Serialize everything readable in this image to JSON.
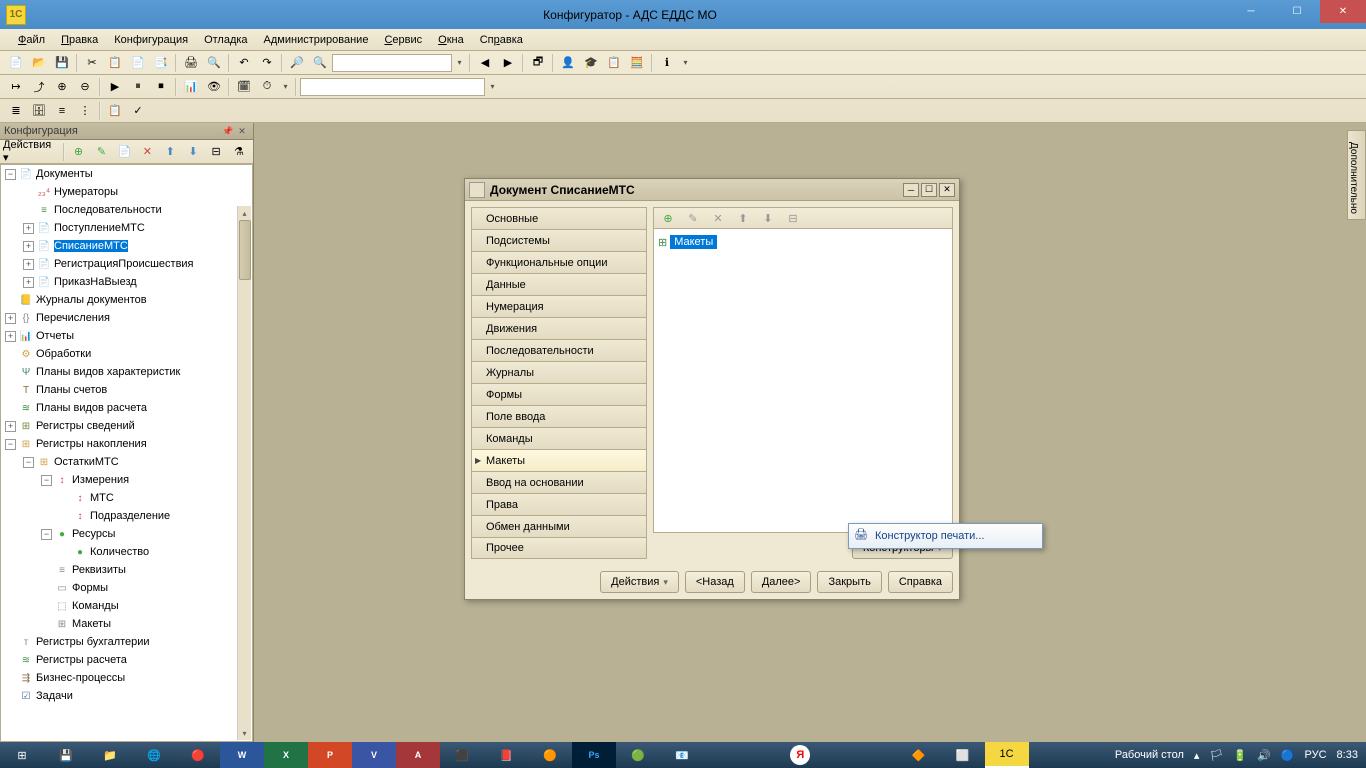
{
  "title": "Конфигуратор - АДС ЕДДС МО",
  "menu": [
    "Файл",
    "Правка",
    "Конфигурация",
    "Отладка",
    "Администрирование",
    "Сервис",
    "Окна",
    "Справка"
  ],
  "sidebar": {
    "title": "Конфигурация",
    "actions_label": "Действия"
  },
  "tree": [
    {
      "level": 0,
      "toggle": "−",
      "icon": "📄",
      "label": "Документы",
      "color": "#3a6ea5"
    },
    {
      "level": 1,
      "toggle": "",
      "icon": "₂₃⁴",
      "label": "Нумераторы",
      "color": "#c95050"
    },
    {
      "level": 1,
      "toggle": "",
      "icon": "≡",
      "label": "Последовательности",
      "color": "#4a8c4a"
    },
    {
      "level": 1,
      "toggle": "+",
      "icon": "📄",
      "label": "ПоступлениеМТС",
      "color": "#888"
    },
    {
      "level": 1,
      "toggle": "+",
      "icon": "📄",
      "label": "СписаниеМТС",
      "color": "#888",
      "selected": true
    },
    {
      "level": 1,
      "toggle": "+",
      "icon": "📄",
      "label": "РегистрацияПроисшествия",
      "color": "#888"
    },
    {
      "level": 1,
      "toggle": "+",
      "icon": "📄",
      "label": "ПриказНаВыезд",
      "color": "#888"
    },
    {
      "level": 0,
      "toggle": "",
      "icon": "📒",
      "label": "Журналы документов",
      "color": "#d4a040"
    },
    {
      "level": 0,
      "toggle": "+",
      "icon": "{}",
      "label": "Перечисления",
      "color": "#888"
    },
    {
      "level": 0,
      "toggle": "+",
      "icon": "📊",
      "label": "Отчеты",
      "color": "#4a6e8c"
    },
    {
      "level": 0,
      "toggle": "",
      "icon": "⚙",
      "label": "Обработки",
      "color": "#d4a040"
    },
    {
      "level": 0,
      "toggle": "",
      "icon": "Ψ",
      "label": "Планы видов характеристик",
      "color": "#3a8c6e"
    },
    {
      "level": 0,
      "toggle": "",
      "icon": "Т",
      "label": "Планы счетов",
      "color": "#8c6e3a"
    },
    {
      "level": 0,
      "toggle": "",
      "icon": "≋",
      "label": "Планы видов расчета",
      "color": "#3a8c3a"
    },
    {
      "level": 0,
      "toggle": "+",
      "icon": "⊞",
      "label": "Регистры сведений",
      "color": "#6e8c3a"
    },
    {
      "level": 0,
      "toggle": "−",
      "icon": "⊞",
      "label": "Регистры накопления",
      "color": "#d4a040"
    },
    {
      "level": 1,
      "toggle": "−",
      "icon": "⊞",
      "label": "ОстаткиМТС",
      "color": "#d4a040"
    },
    {
      "level": 2,
      "toggle": "−",
      "icon": "↕",
      "label": "Измерения",
      "color": "#c44"
    },
    {
      "level": 3,
      "toggle": "",
      "icon": "↕",
      "label": "МТС",
      "color": "#c44"
    },
    {
      "level": 3,
      "toggle": "",
      "icon": "↕",
      "label": "Подразделение",
      "color": "#c44"
    },
    {
      "level": 2,
      "toggle": "−",
      "icon": "●",
      "label": "Ресурсы",
      "color": "#4a4"
    },
    {
      "level": 3,
      "toggle": "",
      "icon": "●",
      "label": "Количество",
      "color": "#4a4"
    },
    {
      "level": 2,
      "toggle": "",
      "icon": "≡",
      "label": "Реквизиты",
      "color": "#888"
    },
    {
      "level": 2,
      "toggle": "",
      "icon": "▭",
      "label": "Формы",
      "color": "#888"
    },
    {
      "level": 2,
      "toggle": "",
      "icon": "⬚",
      "label": "Команды",
      "color": "#888"
    },
    {
      "level": 2,
      "toggle": "",
      "icon": "⊞",
      "label": "Макеты",
      "color": "#888"
    },
    {
      "level": 0,
      "toggle": "",
      "icon": "т",
      "label": "Регистры бухгалтерии",
      "color": "#888"
    },
    {
      "level": 0,
      "toggle": "",
      "icon": "≋",
      "label": "Регистры расчета",
      "color": "#4a8c4a"
    },
    {
      "level": 0,
      "toggle": "",
      "icon": "⇶",
      "label": "Бизнес-процессы",
      "color": "#8c6e4a"
    },
    {
      "level": 0,
      "toggle": "",
      "icon": "☑",
      "label": "Задачи",
      "color": "#4a6e8c"
    }
  ],
  "doc_window": {
    "title": "Документ СписаниеМТС",
    "tabs": [
      "Основные",
      "Подсистемы",
      "Функциональные опции",
      "Данные",
      "Нумерация",
      "Движения",
      "Последовательности",
      "Журналы",
      "Формы",
      "Поле ввода",
      "Команды",
      "Макеты",
      "Ввод на основании",
      "Права",
      "Обмен данными",
      "Прочее"
    ],
    "active_tab": "Макеты",
    "tree_label": "Макеты",
    "buttons": {
      "actions": "Действия",
      "back": "<Назад",
      "next": "Далее>",
      "close": "Закрыть",
      "help": "Справка",
      "constructors": "Конструкторы"
    },
    "popup": "Конструктор печати..."
  },
  "side_tab": "Дополнительно",
  "taskbar": {
    "desk": "Рабочий стол",
    "lang": "РУС",
    "time": "8:33"
  }
}
